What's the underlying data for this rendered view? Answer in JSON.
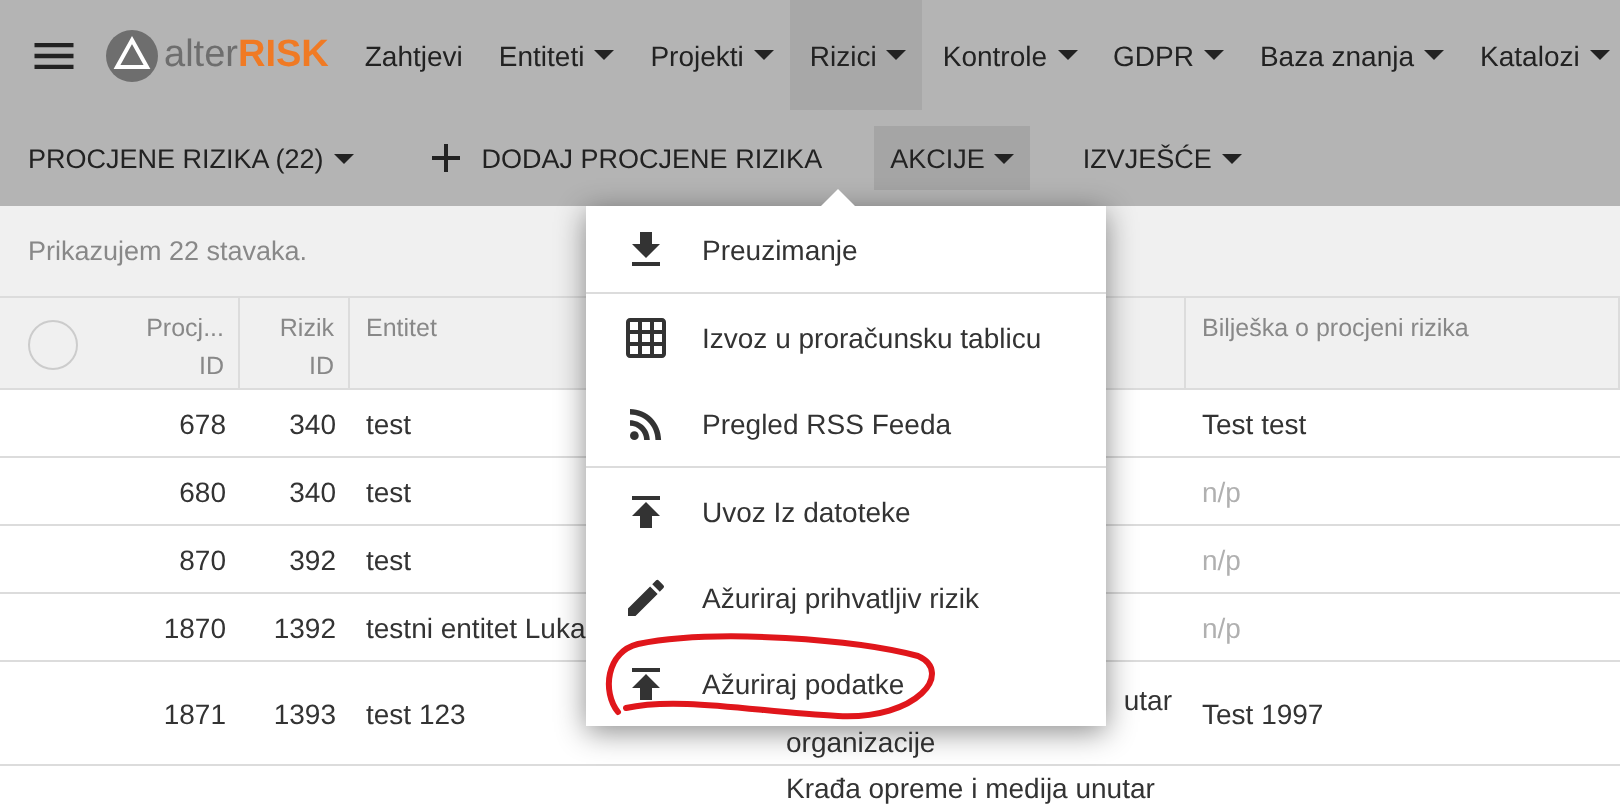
{
  "logo": {
    "prefix": "alter",
    "suffix": "RISK"
  },
  "nav": [
    {
      "label": "Zahtjevi",
      "dropdown": false,
      "selected": false
    },
    {
      "label": "Entiteti",
      "dropdown": true,
      "selected": false
    },
    {
      "label": "Projekti",
      "dropdown": true,
      "selected": false
    },
    {
      "label": "Rizici",
      "dropdown": true,
      "selected": true
    },
    {
      "label": "Kontrole",
      "dropdown": true,
      "selected": false
    },
    {
      "label": "GDPR",
      "dropdown": true,
      "selected": false
    },
    {
      "label": "Baza znanja",
      "dropdown": true,
      "selected": false
    },
    {
      "label": "Katalozi",
      "dropdown": true,
      "selected": false
    }
  ],
  "toolbar": [
    {
      "label": "PROCJENE RIZIKA (22)",
      "kind": "dropdown",
      "selected": false
    },
    {
      "label": "DODAJ PROCJENE RIZIKA",
      "kind": "add",
      "selected": false
    },
    {
      "label": "AKCIJE",
      "kind": "dropdown",
      "selected": true
    },
    {
      "label": "IZVJEŠĆE",
      "kind": "dropdown",
      "selected": false
    }
  ],
  "summary": "Prikazujem 22 stavaka.",
  "table": {
    "select_all": {
      "checked": false
    },
    "columns": [
      "Procj... ID",
      "Rizik ID",
      "Entitet",
      null,
      "Bilješka o procjeni rizika"
    ],
    "rows": [
      {
        "cells": [
          "678",
          "340",
          "test",
          null,
          "Test test"
        ],
        "note_empty": false
      },
      {
        "cells": [
          "680",
          "340",
          "test",
          null,
          "n/p"
        ],
        "note_empty": true
      },
      {
        "cells": [
          "870",
          "392",
          "test",
          null,
          "n/p"
        ],
        "note_empty": true
      },
      {
        "cells": [
          "1870",
          "1392",
          "testni entitet Luka",
          null,
          "n/p"
        ],
        "note_empty": true
      },
      {
        "cells": [
          "1871",
          "1393",
          "test 123",
          [
            "utar",
            "organizacije"
          ],
          "Test 1997"
        ],
        "note_empty": false
      },
      {
        "cells": [
          null,
          null,
          null,
          [
            "Krađa opreme i medija unutar"
          ],
          null
        ]
      }
    ]
  },
  "menu": {
    "groups": [
      {
        "items": [
          {
            "label": "Preuzimanje",
            "kind": "download"
          }
        ]
      },
      {
        "items": [
          {
            "label": "Izvoz u proračunsku tablicu",
            "kind": "grid"
          },
          {
            "label": "Pregled RSS Feeda",
            "kind": "rss"
          }
        ]
      },
      {
        "items": [
          {
            "label": "Uvoz Iz datoteke",
            "kind": "upload"
          },
          {
            "label": "Ažuriraj prihvatljiv rizik",
            "kind": "edit"
          },
          {
            "label": "Ažuriraj podatke",
            "kind": "upload",
            "circled": true
          }
        ]
      }
    ]
  }
}
